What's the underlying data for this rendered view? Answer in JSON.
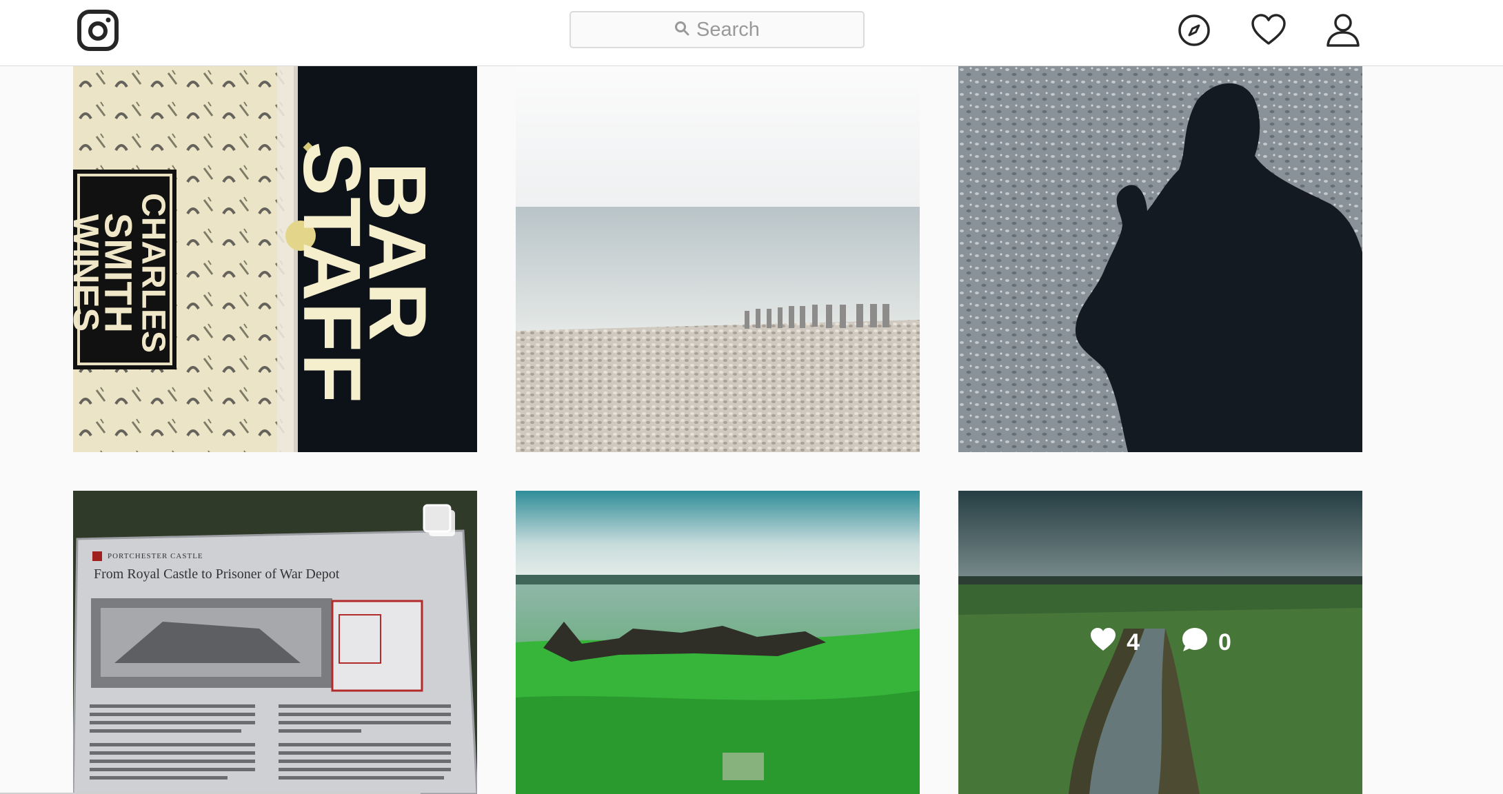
{
  "header": {
    "search_placeholder": "Search",
    "icons": [
      "instagram-logo-icon",
      "search-icon",
      "compass-icon",
      "heart-icon",
      "user-icon"
    ]
  },
  "posts": [
    {
      "id": "bar-staff",
      "shirt_text": [
        "BAR",
        "STAFF"
      ],
      "tag_text": [
        "CHARLES",
        "SMITH",
        "WINES"
      ]
    },
    {
      "id": "beach"
    },
    {
      "id": "shadow"
    },
    {
      "id": "sign",
      "sign_org": "PORTCHESTER CASTLE",
      "sign_title": "From Royal Castle to Prisoner of War Depot",
      "multi": true
    },
    {
      "id": "wrecks"
    },
    {
      "id": "creek",
      "likes": "4",
      "comments": "0"
    }
  ],
  "colors": {
    "border": "#dbdbdb",
    "background": "#fafafa",
    "icon": "#262626"
  }
}
